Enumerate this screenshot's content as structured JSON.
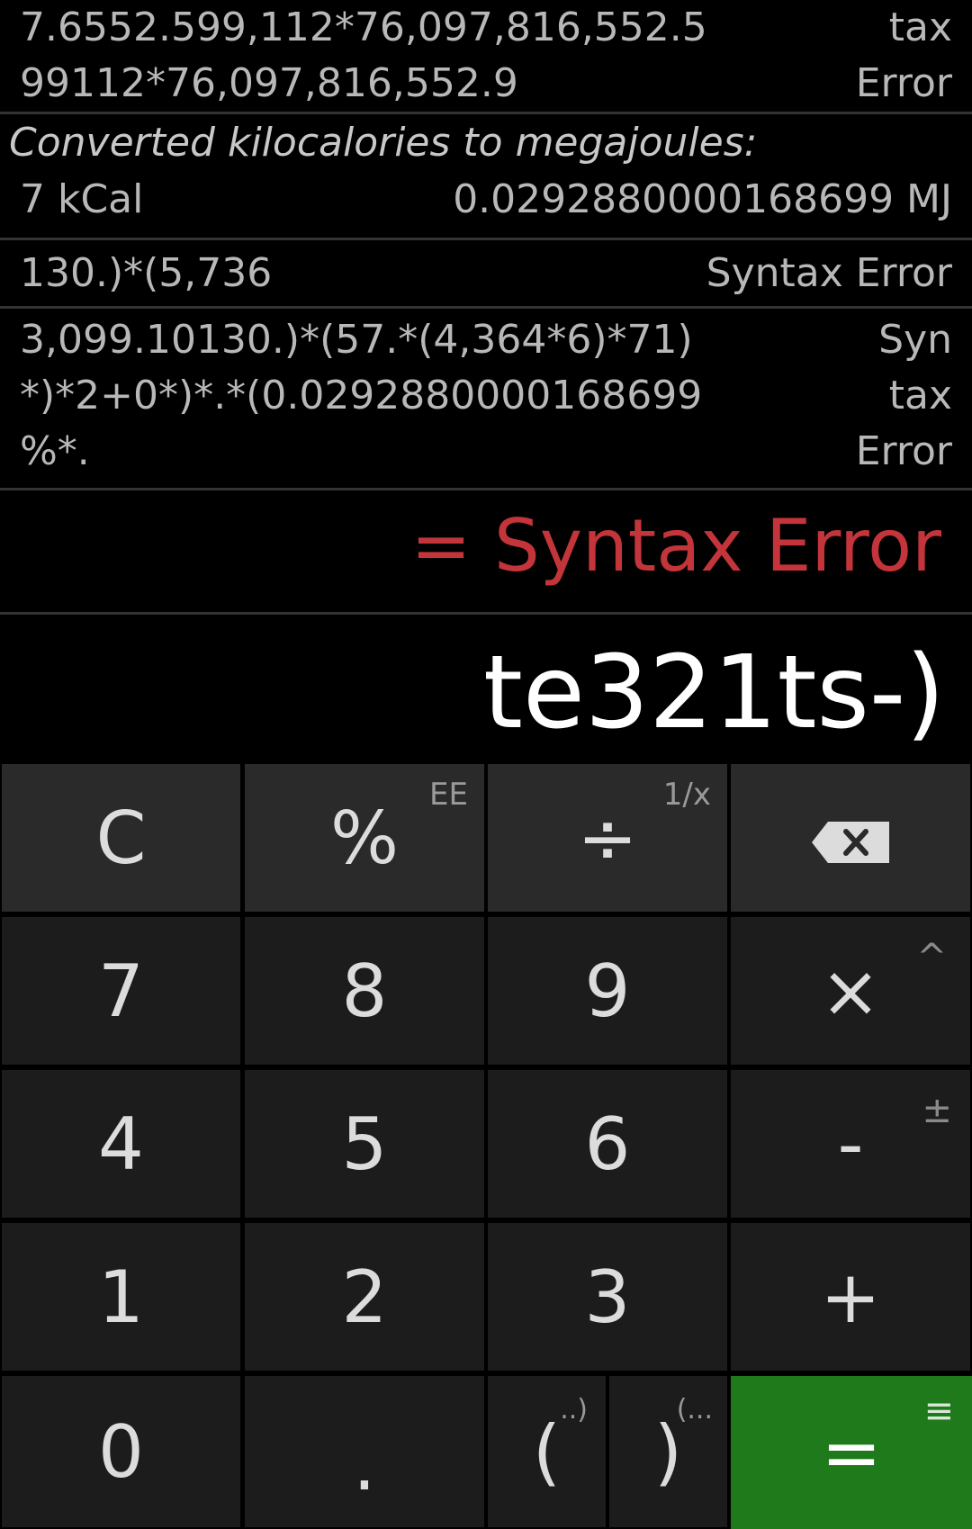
{
  "history": {
    "entry1": {
      "expression": "7.6552.599,112*76,097,816,552.5\n99112*76,097,816,552.9",
      "result": "tax\nError"
    },
    "conversion": {
      "title": "Converted kilocalories to megajoules:",
      "from": "7 kCal",
      "to": "0.0292880000168699 MJ"
    },
    "entry2": {
      "expression": "130.)*(5,736",
      "result": "Syntax Error"
    },
    "entry3": {
      "expression": "3,099.10130.)*(57.*(4,364*6)*71)\n*)*2+0*)*.*(0.0292880000168699\n%*.",
      "result": "Syn\ntax\nError"
    }
  },
  "display": {
    "result": "= Syntax Error",
    "input": "te321ts-)"
  },
  "keys": {
    "clear": "C",
    "percent": "%",
    "percent_secondary": "EE",
    "divide": "÷",
    "divide_secondary": "1/x",
    "seven": "7",
    "eight": "8",
    "nine": "9",
    "multiply": "×",
    "multiply_secondary": "^",
    "four": "4",
    "five": "5",
    "six": "6",
    "minus": "-",
    "minus_secondary": "±",
    "one": "1",
    "two": "2",
    "three": "3",
    "plus": "+",
    "zero": "0",
    "dot": ".",
    "open_paren": "(",
    "open_paren_secondary": "..)",
    "close_paren": ")",
    "close_paren_secondary": "(...",
    "equals": "=",
    "equals_secondary": "≡"
  },
  "colors": {
    "error": "#c3353a",
    "equals_key": "#1f7a1c"
  },
  "icons": {
    "backspace": "backspace-icon"
  }
}
